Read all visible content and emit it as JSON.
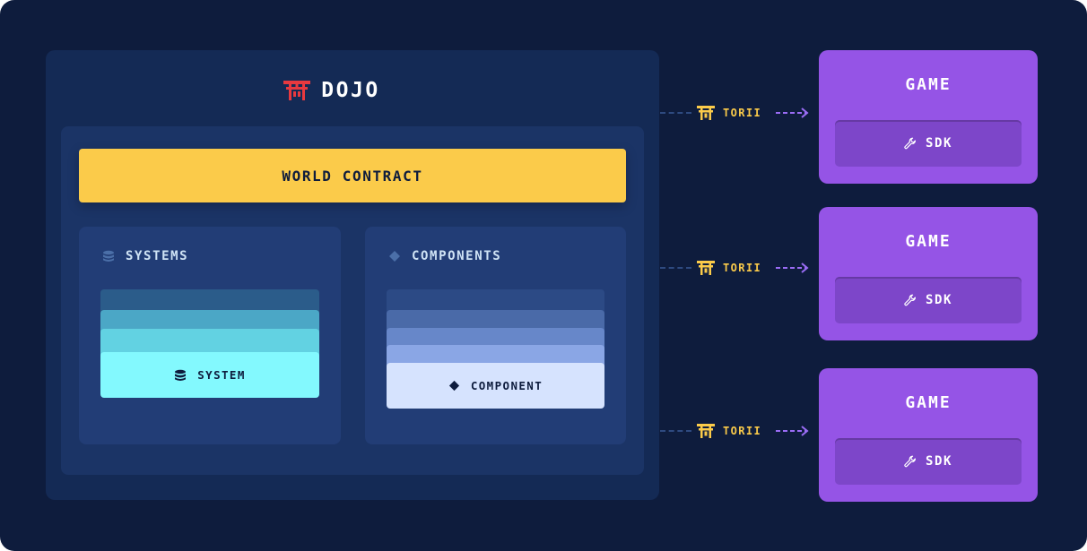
{
  "dojo": {
    "title": "DOJO"
  },
  "world": {
    "label": "WORLD CONTRACT"
  },
  "systems": {
    "title": "SYSTEMS",
    "item_label": "SYSTEM"
  },
  "components": {
    "title": "COMPONENTS",
    "item_label": "COMPONENT"
  },
  "connectors": [
    {
      "label": "TORII"
    },
    {
      "label": "TORII"
    },
    {
      "label": "TORII"
    }
  ],
  "games": [
    {
      "title": "GAME",
      "sdk_label": "SDK"
    },
    {
      "title": "GAME",
      "sdk_label": "SDK"
    },
    {
      "title": "GAME",
      "sdk_label": "SDK"
    }
  ],
  "colors": {
    "background": "#0e1c3d",
    "dojo_panel": "#142a55",
    "world_contract": "#fbcb4a",
    "game": "#9554e6",
    "sdk": "#7d46c9",
    "dojo_logo": "#e8393f",
    "torii": "#fbcb4a",
    "arrow": "#9a6cf5"
  },
  "icons": {
    "dojo_logo": "torii-gate-logo",
    "systems": "database-icon",
    "components": "diamond-icon",
    "torii": "torii-gate-icon",
    "sdk": "wrench-icon"
  }
}
